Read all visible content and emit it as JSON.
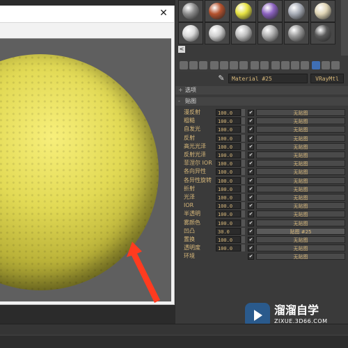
{
  "render_window": {
    "close_glyph": "✕"
  },
  "material_editor": {
    "material_name": "Material #25",
    "material_type": "VRayMtl",
    "rollouts": {
      "options_sign": "+",
      "options_label": "选项",
      "maps_sign": "-",
      "maps_label": "贴图"
    },
    "sample_slots": [
      {
        "color": "#8d8d8d"
      },
      {
        "color": "#b4522e"
      },
      {
        "color": "#e6e242"
      },
      {
        "color": "#8b62bf"
      },
      {
        "color": "#a8adb7"
      },
      {
        "color": "#dfd5b5"
      },
      {
        "color": "#d9d9d9"
      },
      {
        "color": "#cfcfcf"
      },
      {
        "color": "#bfbfbf"
      },
      {
        "color": "#b0b0b0"
      },
      {
        "color": "#999999"
      },
      {
        "color": "#5a5a5a"
      }
    ],
    "maps": [
      {
        "label": "漫反射",
        "amount": "100.0",
        "checked": "✔",
        "slot": "无贴图",
        "filled": false
      },
      {
        "label": "粗糙",
        "amount": "100.0",
        "checked": "✔",
        "slot": "无贴图",
        "filled": false
      },
      {
        "label": "自发光",
        "amount": "100.0",
        "checked": "✔",
        "slot": "无贴图",
        "filled": false
      },
      {
        "label": "反射",
        "amount": "100.0",
        "checked": "✔",
        "slot": "无贴图",
        "filled": false
      },
      {
        "label": "高光光泽",
        "amount": "100.0",
        "checked": "✔",
        "slot": "无贴图",
        "filled": false
      },
      {
        "label": "反射光泽",
        "amount": "100.0",
        "checked": "✔",
        "slot": "无贴图",
        "filled": false
      },
      {
        "label": "菲涅尔 IOR",
        "amount": "100.0",
        "checked": "✔",
        "slot": "无贴图",
        "filled": false
      },
      {
        "label": "各向异性",
        "amount": "100.0",
        "checked": "✔",
        "slot": "无贴图",
        "filled": false
      },
      {
        "label": "各异性旋转",
        "amount": "100.0",
        "checked": "✔",
        "slot": "无贴图",
        "filled": false
      },
      {
        "label": "折射",
        "amount": "100.0",
        "checked": "✔",
        "slot": "无贴图",
        "filled": false
      },
      {
        "label": "光泽",
        "amount": "100.0",
        "checked": "✔",
        "slot": "无贴图",
        "filled": false
      },
      {
        "label": "IOR",
        "amount": "100.0",
        "checked": "✔",
        "slot": "无贴图",
        "filled": false
      },
      {
        "label": "半透明",
        "amount": "100.0",
        "checked": "✔",
        "slot": "无贴图",
        "filled": false
      },
      {
        "label": "雾颜色",
        "amount": "100.0",
        "checked": "✔",
        "slot": "无贴图",
        "filled": false
      },
      {
        "label": "凹凸",
        "amount": "30.0",
        "checked": "✔",
        "slot": "贴图 #25",
        "filled": true
      },
      {
        "label": "置换",
        "amount": "100.0",
        "checked": "✔",
        "slot": "无贴图",
        "filled": false
      },
      {
        "label": "透明度",
        "amount": "100.0",
        "checked": "✔",
        "slot": "无贴图",
        "filled": false
      },
      {
        "label": "环境",
        "amount": "",
        "checked": "✔",
        "slot": "无贴图",
        "filled": false
      }
    ]
  },
  "watermark": {
    "title": "溜溜自学",
    "url": "ZIXUE.3D66.COM"
  },
  "colors": {
    "sphere": "#e6df55",
    "arrow": "#ff3b1f",
    "label_text": "#d8b87a"
  }
}
